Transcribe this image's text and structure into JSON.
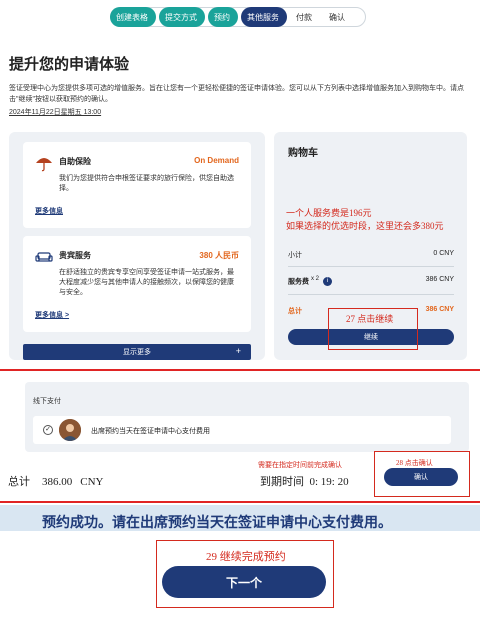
{
  "stepper": {
    "steps": [
      {
        "label": "创建表格",
        "state": "done"
      },
      {
        "label": "提交方式",
        "state": "done"
      },
      {
        "label": "预约",
        "state": "done"
      },
      {
        "label": "其他服务",
        "state": "current"
      },
      {
        "label": "付款",
        "state": "todo"
      },
      {
        "label": "确认",
        "state": "todo"
      }
    ]
  },
  "header": {
    "title": "提升您的申请体验",
    "intro": "签证受理中心为您提供多项可选的增值服务。旨在让您有一个更轻松便捷的签证申请体验。您可以从下方列表中选择增值服务加入到购物车中。请点击\"继续\"按钮以获取预约的确认。",
    "datetime": "2024年11月22日星期五 13:00"
  },
  "services": [
    {
      "name": "自助保险",
      "price": "On Demand",
      "description": "我们为您提供符合申根签证要求的旅行保险，供您自助选择。",
      "more": "更多信息",
      "icon": "umbrella-icon"
    },
    {
      "name": "贵宾服务",
      "price": "380 人民币",
      "description": "在舒适独立的贵宾专享空间享受签证申请一站式服务，最大程度减少您与其他申请人的接触频次，以保障您的健康与安全。",
      "more": "更多信息 >",
      "icon": "sofa-icon"
    }
  ],
  "show_more": {
    "label": "显示更多",
    "icon": "+"
  },
  "cart": {
    "title": "购物车",
    "subtotal_label": "小计",
    "subtotal_value": "0 CNY",
    "fee_label": "服务费",
    "fee_qty": "x 2",
    "fee_value": "386 CNY",
    "total_label": "总计",
    "total_value": "386 CNY",
    "continue_label": "继续"
  },
  "annotations": {
    "cart_note_1": "一个人服务费是196元",
    "cart_note_2": "如果选择的优选时段，这里还会多380元",
    "step27": "27  点击继续",
    "need_confirm": "需要在指定时间前完成确认",
    "step28": "28 点击确认",
    "step29": "29  继续完成预约"
  },
  "payment": {
    "label": "线下支付",
    "option": "出席预约当天在签证申请中心支付费用",
    "total_label": "总计",
    "total_amount": "386.00",
    "total_currency": "CNY",
    "due_label": "到期时间",
    "due_value": "0: 19: 20",
    "confirm_label": "确认"
  },
  "success": {
    "message": "预约成功。请在出席预约当天在签证申请中心支付费用。",
    "next_label": "下一个"
  },
  "colors": {
    "primary": "#1f3a78",
    "done": "#1aa39a",
    "accent": "#e2661d",
    "annotation": "#d42a1e"
  }
}
